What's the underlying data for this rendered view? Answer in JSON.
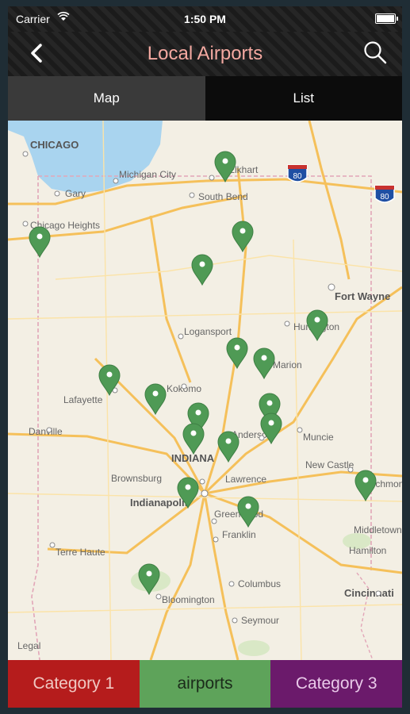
{
  "status": {
    "carrier": "Carrier",
    "time": "1:50 PM"
  },
  "header": {
    "title": "Local Airports"
  },
  "tabs": [
    {
      "label": "Map"
    },
    {
      "label": "List"
    }
  ],
  "map": {
    "labels": {
      "chicago": "CHICAGO",
      "gary": "Gary",
      "michigan_city": "Michigan City",
      "elkhart": "Elkhart",
      "south_bend": "South Bend",
      "chicago_heights": "Chicago Heights",
      "fort_wayne": "Fort Wayne",
      "logansport": "Logansport",
      "huntington": "Huntington",
      "marion": "Marion",
      "lafayette": "Lafayette",
      "kokomo": "Kokomo",
      "danville": "Danville",
      "anderson": "Anderson",
      "muncie": "Muncie",
      "indiana": "INDIANA",
      "new_castle": "New Castle",
      "brownsburg": "Brownsburg",
      "lawrence": "Lawrence",
      "indianapolis": "Indianapolis",
      "greenwood": "Greenwood",
      "richmond": "Richmond",
      "middletown": "Middletown",
      "hamilton": "Hamilton",
      "franklin": "Franklin",
      "terre_haute": "Terre Haute",
      "columbus": "Columbus",
      "bloomington": "Bloomington",
      "seymour": "Seymour",
      "cincinnati": "Cincinnati",
      "legal": "Legal",
      "i80_a": "80",
      "i80_b": "80"
    }
  },
  "bottom": {
    "cat1": "Category 1",
    "cat2": "airports",
    "cat3": "Category 3"
  },
  "colors": {
    "pin": "#4f9a55",
    "cat1": "#b51c1c",
    "cat2": "#5ea35a",
    "cat3": "#6b1a6b",
    "title": "#f4a9a1"
  }
}
